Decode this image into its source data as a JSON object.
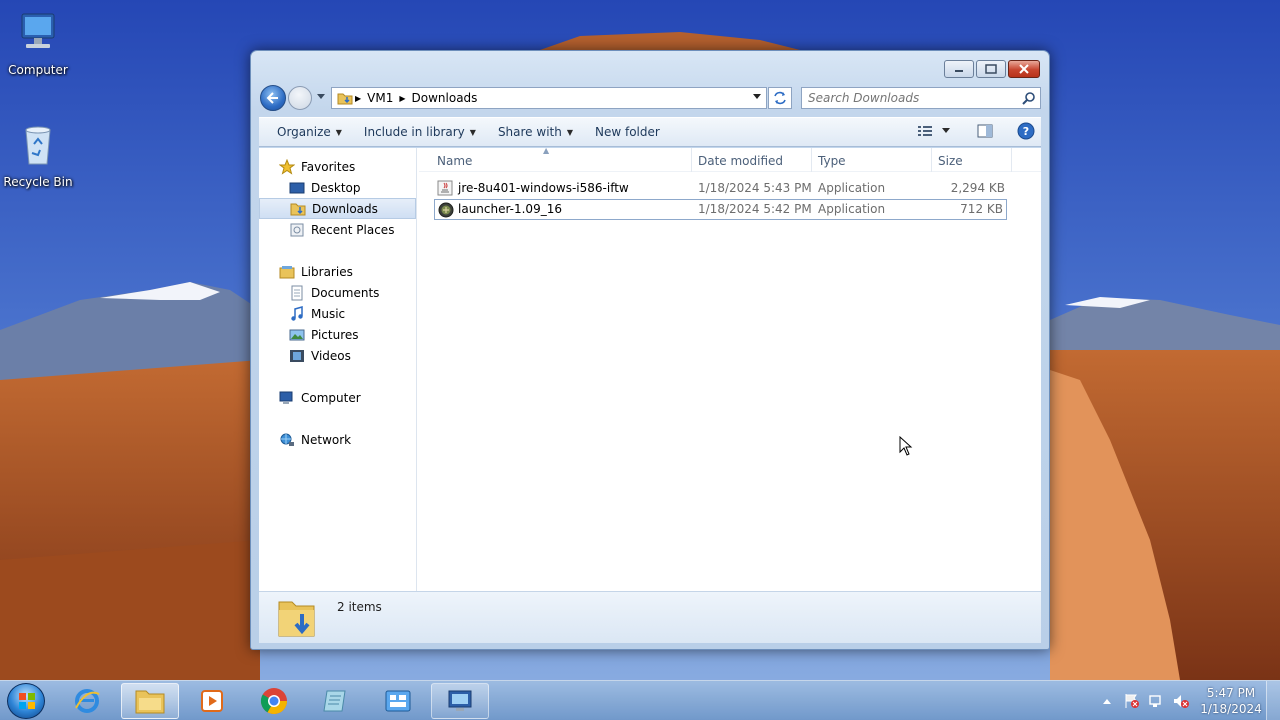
{
  "desktop": {
    "icons": [
      {
        "label": "Computer",
        "icon": "computer-icon"
      },
      {
        "label": "Recycle Bin",
        "icon": "recycle-bin-icon"
      }
    ]
  },
  "window": {
    "breadcrumb": [
      "VM1",
      "Downloads"
    ],
    "search_placeholder": "Search Downloads",
    "toolbar": {
      "organize": "Organize",
      "include_in_library": "Include in library",
      "share_with": "Share with",
      "new_folder": "New folder"
    },
    "nav": {
      "favorites": "Favorites",
      "favorites_items": [
        "Desktop",
        "Downloads",
        "Recent Places"
      ],
      "libraries": "Libraries",
      "libraries_items": [
        "Documents",
        "Music",
        "Pictures",
        "Videos"
      ],
      "computer": "Computer",
      "network": "Network",
      "selected": "Downloads"
    },
    "columns": {
      "name": "Name",
      "date_modified": "Date modified",
      "type": "Type",
      "size": "Size"
    },
    "files": [
      {
        "name": "jre-8u401-windows-i586-iftw",
        "date": "1/18/2024 5:43 PM",
        "type": "Application",
        "size": "2,294 KB",
        "icon": "java-installer-icon"
      },
      {
        "name": "launcher-1.09_16",
        "date": "1/18/2024 5:42 PM",
        "type": "Application",
        "size": "712 KB",
        "icon": "launcher-app-icon"
      }
    ],
    "status": {
      "count": "2 items"
    }
  },
  "taskbar": {
    "apps": [
      "internet-explorer-icon",
      "file-explorer-icon",
      "media-player-icon",
      "chrome-icon",
      "notepad-icon",
      "control-panel-icon",
      "remote-desktop-icon"
    ],
    "clock_time": "5:47 PM",
    "clock_date": "1/18/2024"
  },
  "colors": {
    "selection": "#cfdff3",
    "accent": "#2d6cc4",
    "header_text": "#4c607a"
  }
}
